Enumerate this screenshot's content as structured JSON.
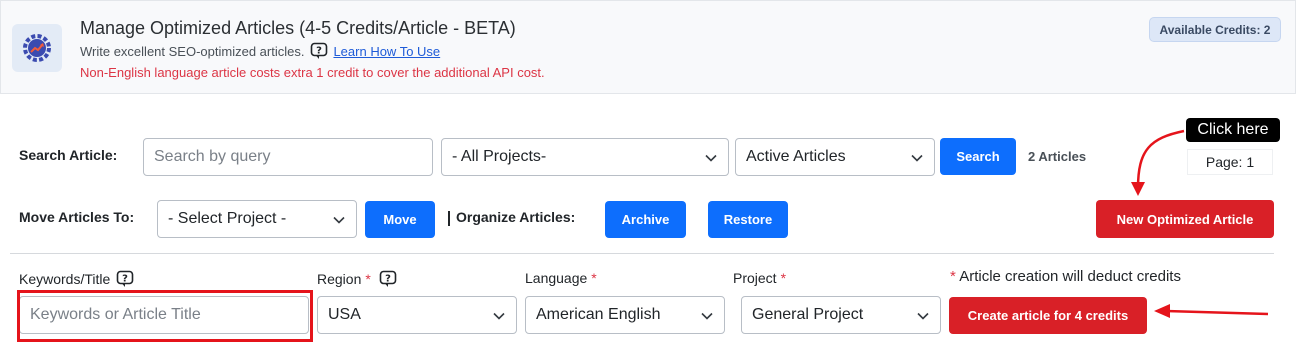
{
  "header": {
    "title": "Manage Optimized Articles (4-5 Credits/Article - BETA)",
    "subtitle": "Write excellent SEO-optimized articles.",
    "learn_link": "Learn How To Use",
    "warning": "Non-English language article costs extra 1 credit to cover the additional API cost.",
    "credits_badge": "Available Credits: 2"
  },
  "search_row": {
    "label": "Search Article:",
    "query_placeholder": "Search by query",
    "projects_value": "- All Projects-",
    "status_value": "Active Articles",
    "search_button": "Search",
    "count": "2 Articles",
    "page": "Page: 1"
  },
  "move_row": {
    "label": "Move Articles To:",
    "project_value": "- Select Project -",
    "move_button": "Move",
    "organize_label": "Organize Articles:",
    "archive_button": "Archive",
    "restore_button": "Restore",
    "new_article_button": "New Optimized Article"
  },
  "form": {
    "keywords_label": "Keywords/Title",
    "keywords_placeholder": "Keywords or Article Title",
    "region_label": "Region",
    "region_value": "USA",
    "language_label": "Language",
    "language_value": "American English",
    "project_label": "Project",
    "project_value": "General Project",
    "required_mark": "*",
    "credit_note": "Article creation will deduct credits",
    "create_button": "Create article for 4 credits"
  },
  "annotation": {
    "callout_text": "Click here",
    "color": "#e5141b"
  },
  "colors": {
    "primary_blue": "#0d6efd",
    "danger_red": "#d92027"
  }
}
